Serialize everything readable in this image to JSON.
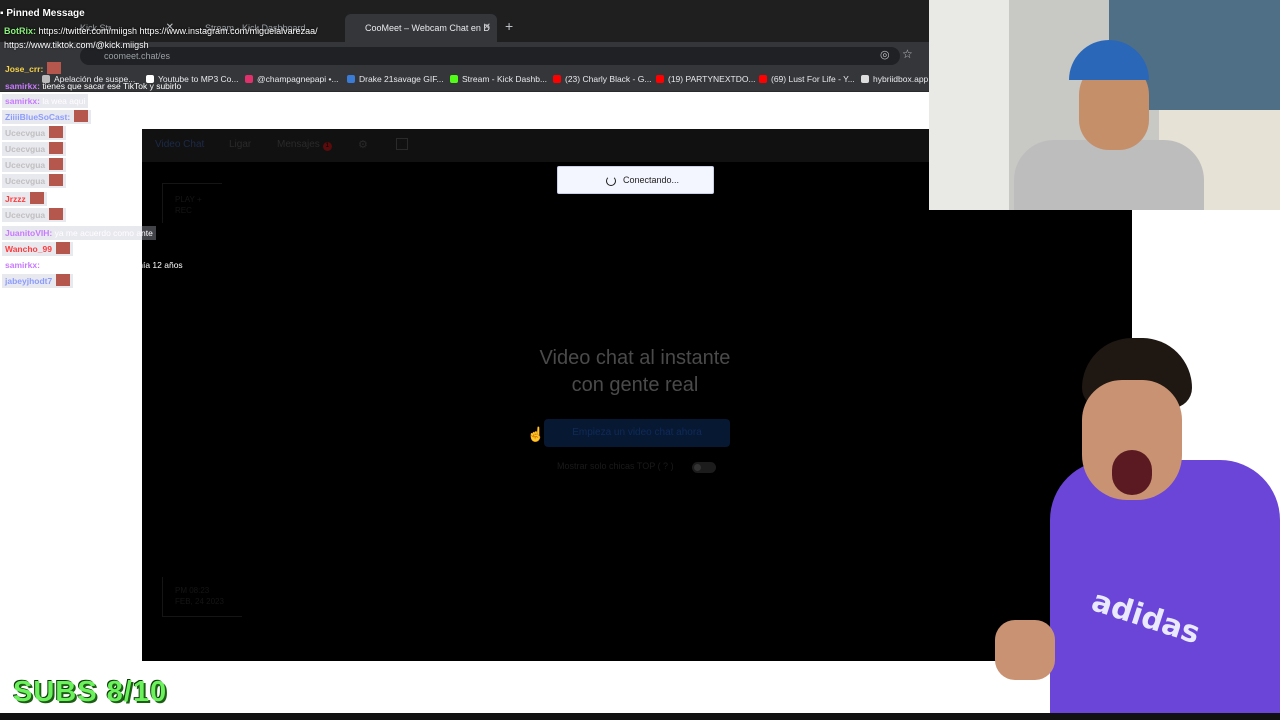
{
  "browser": {
    "tabs": [
      {
        "label": "Kick Str...",
        "active": false
      },
      {
        "label": "Stream - Kick Dashboard",
        "active": false
      },
      {
        "label": "CooMeet – Webcam Chat en D",
        "active": true
      }
    ],
    "url": "coomeet.chat/es",
    "bookmarks": [
      {
        "label": "Apelación de suspe...",
        "color": "#bbbbbb"
      },
      {
        "label": "Youtube to MP3 Co...",
        "color": "#ffffff"
      },
      {
        "label": "@champagnepapi •...",
        "color": "#e1306c"
      },
      {
        "label": "Drake 21savage GIF...",
        "color": "#3a7bd5"
      },
      {
        "label": "Stream - Kick Dashb...",
        "color": "#53fc18"
      },
      {
        "label": "(23) Charly Black - G...",
        "color": "#ff0000"
      },
      {
        "label": "(19) PARTYNEXTDO...",
        "color": "#ff0000"
      },
      {
        "label": "(69) Lust For Life - Y...",
        "color": "#ff0000"
      },
      {
        "label": "hybriidbox.app",
        "color": "#dddddd"
      }
    ]
  },
  "site": {
    "nav": {
      "video_chat": "Video Chat",
      "ligar": "Ligar",
      "mensajes": "Mensajes",
      "mensajes_badge": "1"
    },
    "play_rec": [
      "PLAY +",
      "REC"
    ],
    "hero": [
      "Video chat al instante",
      "con gente real"
    ],
    "start_button": "Empieza un video chat ahora",
    "top_toggle_label": "Mostrar solo chicas TOP",
    "top_toggle_hint": "( ? )",
    "time_line1": "PM 08:23",
    "time_line2": "FEB, 24 2023",
    "toast": "Conectando..."
  },
  "overlay": {
    "pinned_title": "Pinned Message",
    "pinned_lines": [
      {
        "user": "BotRix:",
        "text": " https://twitter.com/miigsh  https://www.instagram.com/miguelalvarezaa/"
      },
      {
        "user": "",
        "text": "https://www.tiktok.com/@kick.miigsh"
      }
    ],
    "chat": [
      {
        "user": "Jose_crr:",
        "text": "",
        "user_color": "#f5d247",
        "dim": false
      },
      {
        "user": "samirkx:",
        "text": " tienes que sacar ese TikTok y subirlo",
        "user_color": "#c879ff",
        "dim": false
      },
      {
        "user": "samirkx:",
        "text": " la wea aqui",
        "user_color": "#c879ff",
        "dim": true
      },
      {
        "user": "ZiiiiBlueSoCast:",
        "text": "",
        "user_color": "#8b9cff",
        "dim": true
      },
      {
        "user": "Ucecvgua",
        "text": "",
        "user_color": "#c0c0c0",
        "dim": true
      },
      {
        "user": "Ucecvgua",
        "text": "",
        "user_color": "#c0c0c0",
        "dim": true
      },
      {
        "user": "Ucecvgua",
        "text": "",
        "user_color": "#c0c0c0",
        "dim": true
      },
      {
        "user": "Ucecvgua",
        "text": "",
        "user_color": "#c0c0c0",
        "dim": true
      },
      {
        "user": "Jrzzz",
        "text": "",
        "user_color": "#ff3c3c",
        "dim": true
      },
      {
        "user": "Ucecvgua",
        "text": "",
        "user_color": "#c0c0c0",
        "dim": true
      },
      {
        "user": "JuanitoVIH:",
        "text": " ya me acuerdo como ante",
        "user_color": "#c879ff",
        "dim": true
      },
      {
        "user": "Wancho_99",
        "text": "",
        "user_color": "#ff3c3c",
        "dim": true
      },
      {
        "user": "samirkx:",
        "text": " yo me acuerdo cuando tenía 12 años",
        "user_color": "#c879ff",
        "dim": false
      },
      {
        "user": "jabeyjhodt7",
        "text": "",
        "user_color": "#8b9cff",
        "dim": true
      }
    ],
    "subs": "SUBS 8/10"
  },
  "colors": {
    "subs_green": "#6bf15c",
    "shirt_purple": "#6a45d8"
  }
}
